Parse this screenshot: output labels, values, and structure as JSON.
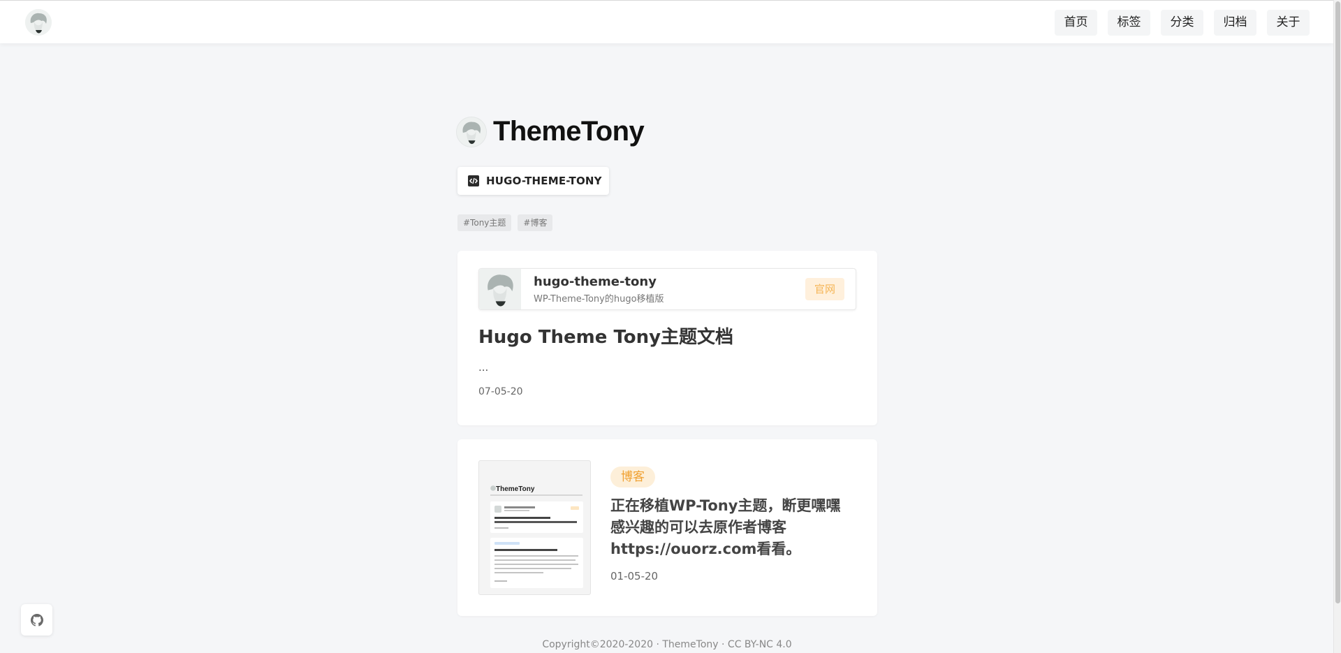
{
  "nav": {
    "items": [
      {
        "label": "首页"
      },
      {
        "label": "标签"
      },
      {
        "label": "分类"
      },
      {
        "label": "归档"
      },
      {
        "label": "关于"
      }
    ]
  },
  "site": {
    "title": "ThemeTony",
    "repo_label": "HUGO-THEME-TONY",
    "tags": [
      "#Tony主题",
      "#博客"
    ]
  },
  "posts": [
    {
      "repo_card": {
        "name": "hugo-theme-tony",
        "description": "WP-Theme-Tony的hugo移植版",
        "badge": "官网"
      },
      "title": "Hugo Theme Tony主题文档",
      "excerpt": "...",
      "date": "07-05-20"
    },
    {
      "category": "博客",
      "title": "正在移植WP-Tony主题，断更嘿嘿感兴趣的可以去原作者博客https://ouorz.com看看。",
      "date": "01-05-20",
      "thumbnail": {
        "site_title": "ThemeTony"
      }
    }
  ],
  "footer": {
    "text": "Copyright©2020-2020 · ThemeTony ·  CC BY-NC 4.0"
  },
  "icons": {
    "avatar": "avatar-icon",
    "code": "code-icon",
    "github": "github-icon"
  },
  "colors": {
    "background": "#f5f6f8",
    "accent_orange": "#f0a030",
    "accent_orange_bg": "#fdefd9"
  }
}
